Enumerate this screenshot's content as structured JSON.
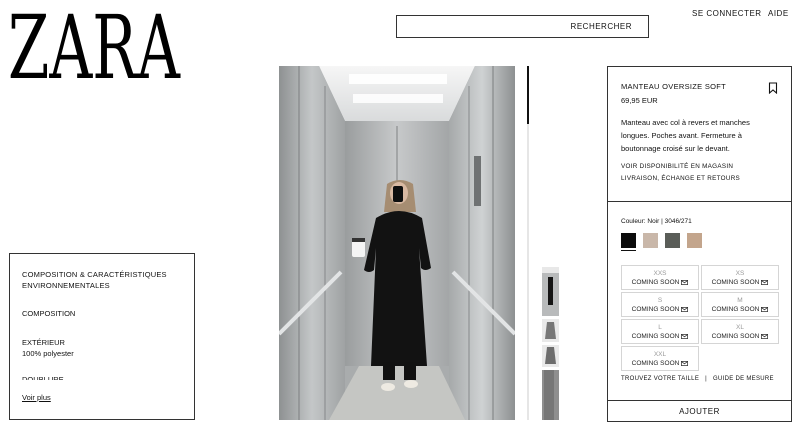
{
  "brand": {
    "logo_text": "ZARA"
  },
  "header": {
    "search_label": "RECHERCHER",
    "login_label": "SE CONNECTER",
    "help_label": "AIDE"
  },
  "composition": {
    "title": "COMPOSITION & CARACTÉRISTIQUES ENVIRONNEMENTALES",
    "subtitle": "COMPOSITION",
    "exterior_label": "EXTÉRIEUR",
    "exterior_value": "100% polyester",
    "lining_label": "DOUBLURE",
    "more_label": "Voir plus"
  },
  "product": {
    "name": "MANTEAU OVERSIZE SOFT",
    "price": "69,95 EUR",
    "description": "Manteau avec col à revers et manches longues. Poches avant. Fermeture à boutonnage croisé sur le devant.",
    "store_link": "VOIR DISPONIBILITÉ EN MAGASIN",
    "delivery_link": "LIVRAISON, ÉCHANGE ET RETOURS",
    "color_label": "Couleur: Noir | 3046/271",
    "colors": [
      "#0b0b0b",
      "#c9b7a9",
      "#5a5d58",
      "#c3a58c"
    ],
    "sizes": [
      {
        "name": "XXS",
        "status": "COMING SOON"
      },
      {
        "name": "XS",
        "status": "COMING SOON"
      },
      {
        "name": "S",
        "status": "COMING SOON"
      },
      {
        "name": "M",
        "status": "COMING SOON"
      },
      {
        "name": "L",
        "status": "COMING SOON"
      },
      {
        "name": "XL",
        "status": "COMING SOON"
      },
      {
        "name": "XXL",
        "status": "COMING SOON"
      }
    ],
    "find_size_label": "TROUVEZ VOTRE TAILLE",
    "guide_separator": "|",
    "guide_label": "GUIDE DE MESURE",
    "add_label": "AJOUTER"
  },
  "icons": {
    "bookmark": "bookmark-icon",
    "mail": "mail-icon"
  }
}
